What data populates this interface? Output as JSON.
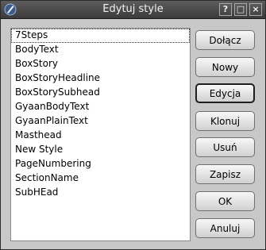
{
  "window": {
    "title": "Edytuj style",
    "help_glyph": "?",
    "maximize_glyph": "□",
    "close_glyph": "×"
  },
  "styles_list": {
    "items": [
      "7Steps",
      "BodyText",
      "BoxStory",
      "BoxStoryHeadline",
      "BoxStorySubhead",
      "GyaanBodyText",
      "GyaanPlainText",
      "Masthead",
      "New Style",
      "PageNumbering",
      "SectionName",
      "SubHEad"
    ],
    "focused_index": 0
  },
  "buttons": {
    "append": "Dołącz",
    "new": "Nowy",
    "edit": "Edycja",
    "clone": "Klonuj",
    "delete": "Usuń",
    "save": "Zapisz",
    "ok": "OK",
    "cancel": "Anuluj"
  },
  "colors": {
    "titlebar": "#4a4a4a",
    "dialog_bg": "#c8c8c8",
    "list_bg": "#ffffff"
  }
}
